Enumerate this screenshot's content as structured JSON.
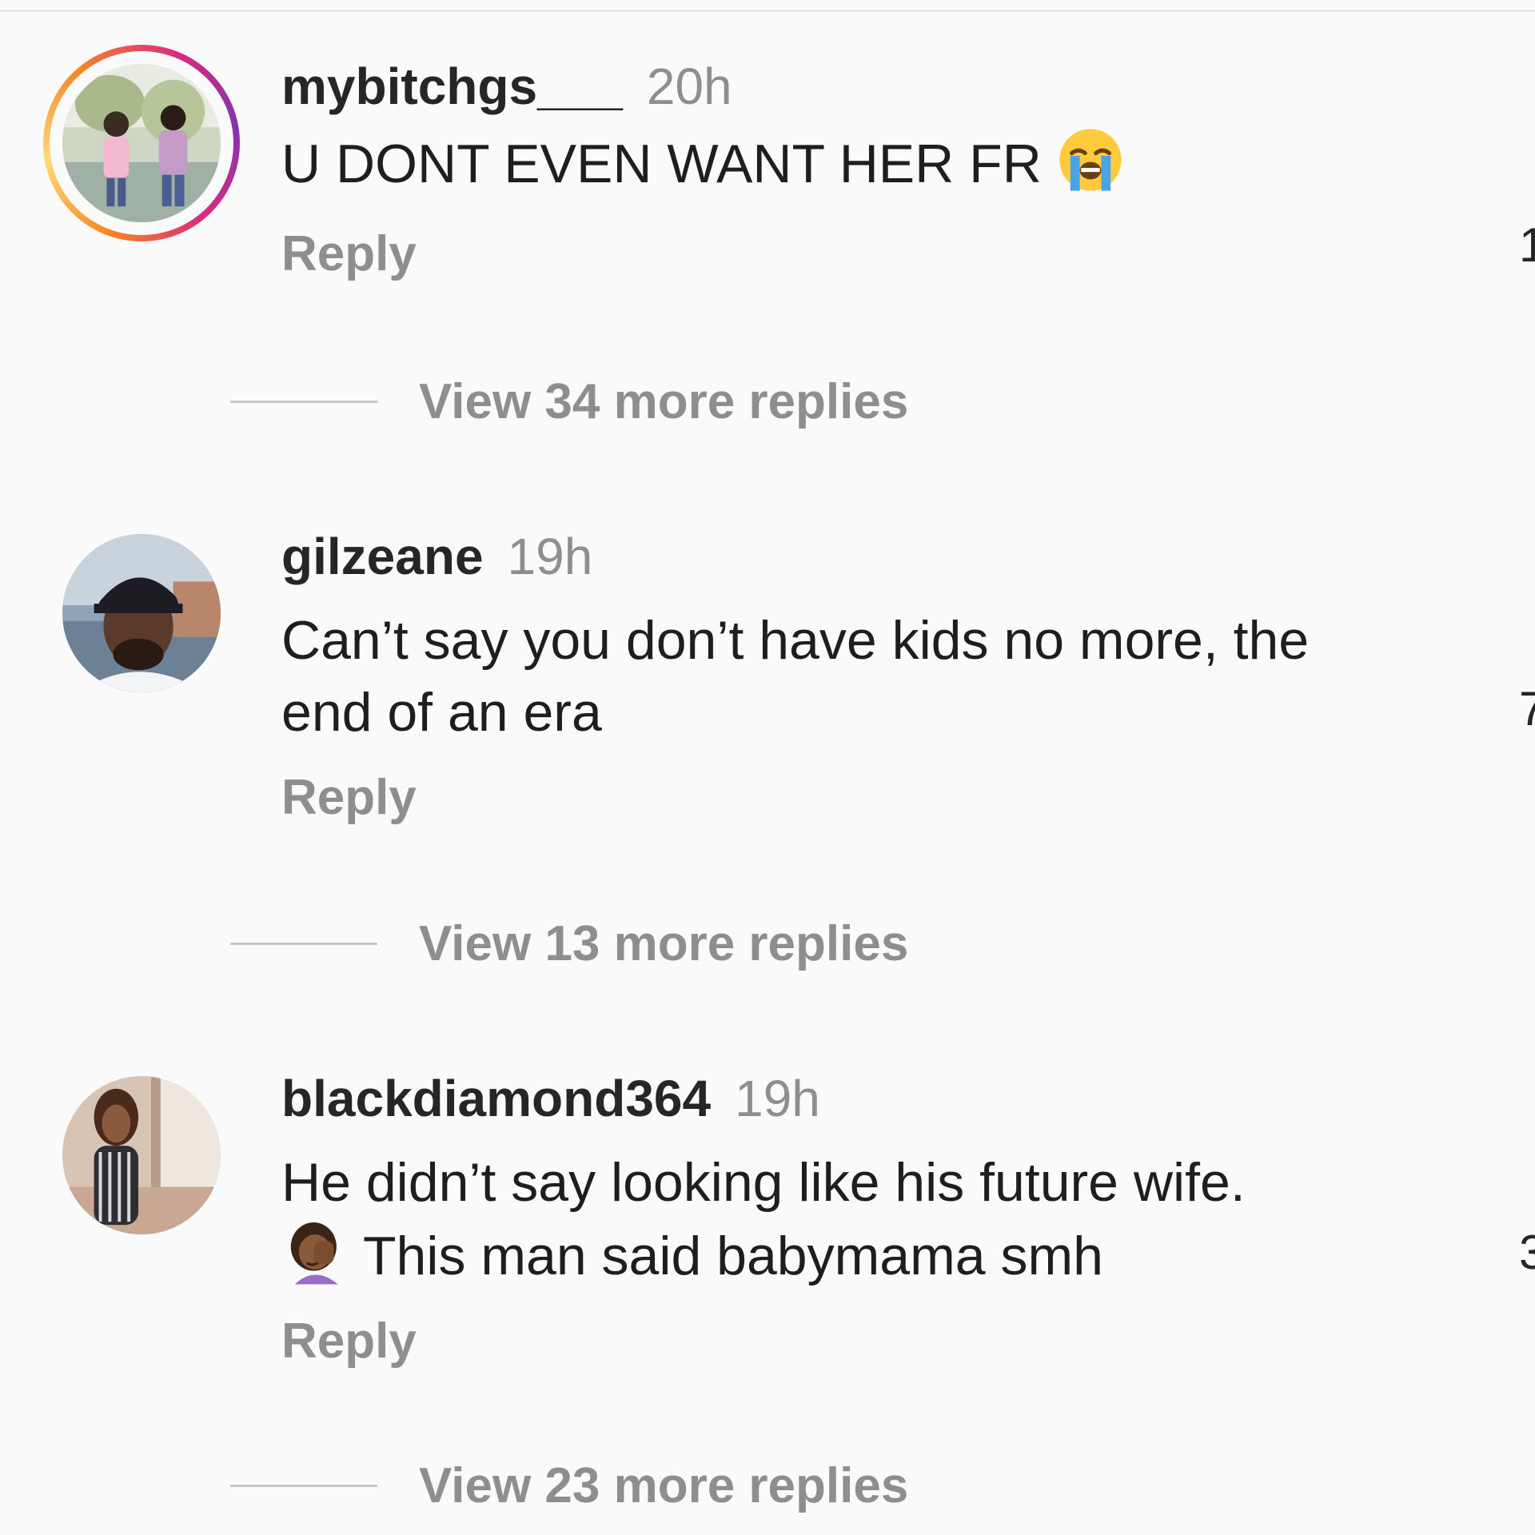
{
  "comments": [
    {
      "username": "mybitchgs___",
      "time": "20h",
      "text": "U DONT EVEN WANT HER FR",
      "text_emoji": "loudly-crying-face",
      "reply_label": "Reply",
      "view_replies": "View 34 more replies",
      "has_story_ring": true,
      "like_count_partial": "1"
    },
    {
      "username": "gilzeane",
      "time": "19h",
      "text_line1": "Can’t say you don’t have kids no more, the",
      "text_line2": "end of an era",
      "reply_label": "Reply",
      "view_replies": "View 13 more replies",
      "has_story_ring": false,
      "like_count_partial": "7"
    },
    {
      "username": "blackdiamond364",
      "time": "19h",
      "text_line1": "He didn’t say looking like his future wife.",
      "text_line2": "This man said babymama smh",
      "text_emoji": "woman-facepalming",
      "reply_label": "Reply",
      "view_replies": "View 23 more replies",
      "has_story_ring": false,
      "like_count_partial": "3"
    }
  ],
  "colors": {
    "background": "#fafafa",
    "primary_text": "#262626",
    "secondary_text": "#8e8e8e",
    "story_ring": [
      "#f58529",
      "#dd2a7b",
      "#8134af"
    ]
  }
}
